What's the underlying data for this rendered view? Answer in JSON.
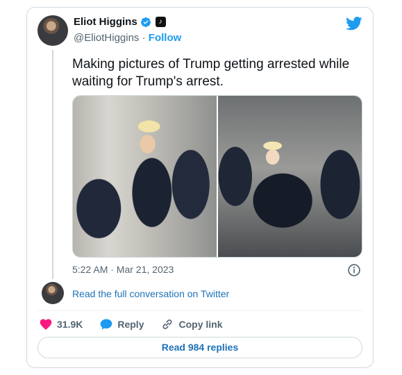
{
  "author": {
    "display_name": "Eliot Higgins",
    "handle": "@EliotHiggins",
    "separator": "·",
    "follow_label": "Follow"
  },
  "tweet": {
    "text": "Making pictures of Trump getting arrested while waiting for Trump's arrest.",
    "timestamp": "5:22 AM · Mar 21, 2023"
  },
  "media": [
    {
      "icon": "photo"
    },
    {
      "icon": "photo"
    }
  ],
  "conversation_link": "Read the full conversation on Twitter",
  "actions": {
    "like_count": "31.9K",
    "reply_label": "Reply",
    "copy_link_label": "Copy link"
  },
  "replies_button": "Read 984 replies",
  "colors": {
    "twitter_blue": "#1d9bf0",
    "link_blue": "#1d72b8",
    "like_pink": "#f91880",
    "muted": "#536471",
    "border": "#cfd9de"
  }
}
